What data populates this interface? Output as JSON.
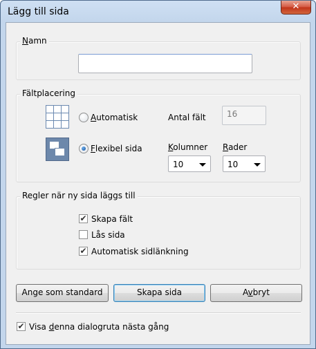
{
  "window": {
    "title": "Lägg till sida",
    "close_glyph": "✕"
  },
  "name_group": {
    "title": "Namn",
    "value": ""
  },
  "placement_group": {
    "title": "Fältplacering",
    "auto": {
      "label": "Automatisk",
      "checked": false
    },
    "flexible": {
      "label": "Flexibel sida",
      "checked": true
    },
    "field_count": {
      "label": "Antal fält",
      "value": "16"
    },
    "columns": {
      "label": "Kolumner",
      "value": "10"
    },
    "rows": {
      "label": "Rader",
      "value": "10"
    },
    "icons": [
      "grid-icon",
      "flexible-page-icon"
    ]
  },
  "rules_group": {
    "title": "Regler när ny sida läggs till",
    "items": [
      {
        "label": "Skapa fält",
        "checked": true
      },
      {
        "label": "Lås sida",
        "checked": false
      },
      {
        "label": "Automatisk sidlänkning",
        "checked": true
      }
    ]
  },
  "buttons": {
    "set_default": "Ange som standard",
    "create": "Skapa sida",
    "cancel": "Avbryt"
  },
  "footer": {
    "show_again": {
      "label": "Visa denna dialogruta nästa gång",
      "checked": true
    }
  },
  "colors": {
    "title_bar": "#c3d6ec",
    "client_bg": "#f0f0f0",
    "close_button": "#c0331a",
    "default_button_border": "#3c7fb1"
  }
}
